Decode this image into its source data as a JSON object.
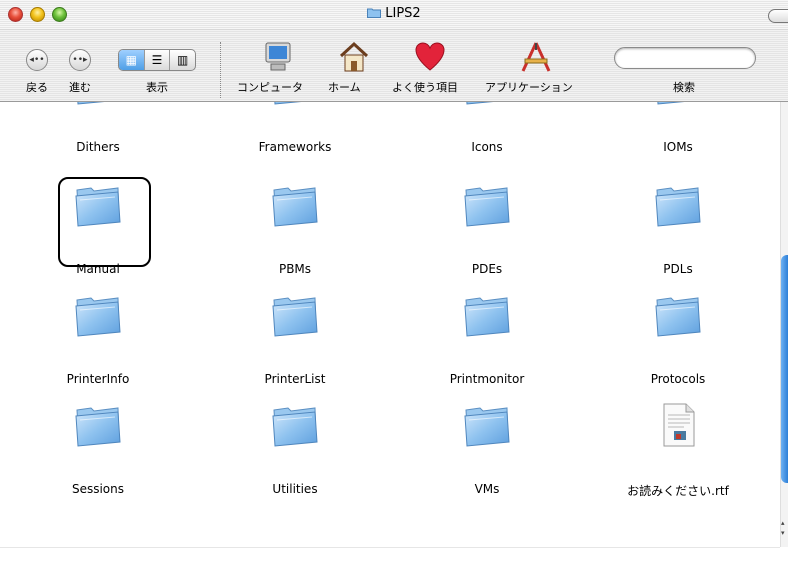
{
  "window": {
    "title": "LIPS2"
  },
  "toolbar": {
    "back_label": "戻る",
    "forward_label": "進む",
    "view_label": "表示",
    "view_modes": [
      "▦",
      "☰",
      "▥"
    ],
    "computer_label": "コンピュータ",
    "home_label": "ホーム",
    "favorites_label": "よく使う項目",
    "applications_label": "アプリケーション",
    "search_label": "検索",
    "search_value": ""
  },
  "items": [
    {
      "name": "Dithers",
      "kind": "folder"
    },
    {
      "name": "Frameworks",
      "kind": "folder"
    },
    {
      "name": "Icons",
      "kind": "folder"
    },
    {
      "name": "IOMs",
      "kind": "folder"
    },
    {
      "name": "Manual",
      "kind": "folder"
    },
    {
      "name": "PBMs",
      "kind": "folder"
    },
    {
      "name": "PDEs",
      "kind": "folder"
    },
    {
      "name": "PDLs",
      "kind": "folder"
    },
    {
      "name": "PrinterInfo",
      "kind": "folder"
    },
    {
      "name": "PrinterList",
      "kind": "folder"
    },
    {
      "name": "Printmonitor",
      "kind": "folder"
    },
    {
      "name": "Protocols",
      "kind": "folder"
    },
    {
      "name": "Sessions",
      "kind": "folder"
    },
    {
      "name": "Utilities",
      "kind": "folder"
    },
    {
      "name": "VMs",
      "kind": "folder"
    },
    {
      "name": "お読みください.rtf",
      "kind": "document"
    }
  ],
  "highlighted_item": "Manual",
  "colors": {
    "scroll_thumb": "#2d7fd7",
    "folder": "#8ec2ef",
    "highlight_border": "#000000"
  }
}
